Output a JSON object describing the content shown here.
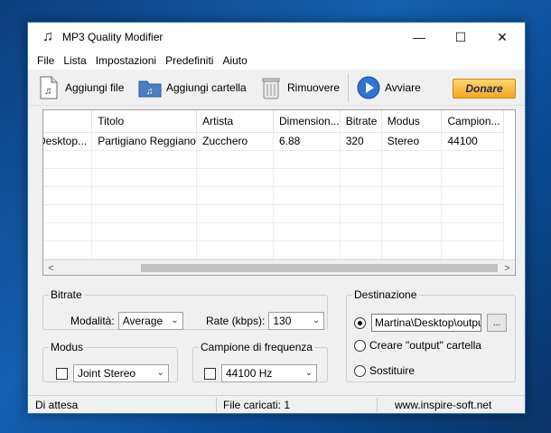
{
  "window": {
    "title": "MP3 Quality Modifier",
    "controls": {
      "minimize": "—",
      "maximize": "☐",
      "close": "✕"
    }
  },
  "menu": [
    "File",
    "Lista",
    "Impostazioni",
    "Predefiniti",
    "Aiuto"
  ],
  "toolbar": {
    "add_files": "Aggiungi file",
    "add_folder": "Aggiungi cartella",
    "remove": "Rimuovere",
    "start": "Avviare",
    "donate": "Donare"
  },
  "table": {
    "columns": [
      "",
      "Titolo",
      "Artista",
      "Dimension...",
      "Bitrate",
      "Modus",
      "Campion..."
    ],
    "rows": [
      [
        "Desktop...",
        "Partigiano Reggiano",
        "Zucchero",
        "6.88",
        "320",
        "Stereo",
        "44100"
      ]
    ]
  },
  "bitrate": {
    "legend": "Bitrate",
    "mode_label": "Modalità:",
    "mode_value": "Average",
    "rate_label": "Rate (kbps):",
    "rate_value": "130"
  },
  "modus": {
    "legend": "Modus",
    "value": "Joint Stereo"
  },
  "frequency": {
    "legend": "Campione di frequenza",
    "value": "44100 Hz"
  },
  "destination": {
    "legend": "Destinazione",
    "path": "Martina\\Desktop\\output\\",
    "browse": "...",
    "option_output": "Creare \"output\" cartella",
    "option_replace": "Sostituire"
  },
  "status": {
    "state": "Di attesa",
    "files_loaded": "File caricati: 1",
    "website": "www.inspire-soft.net"
  }
}
